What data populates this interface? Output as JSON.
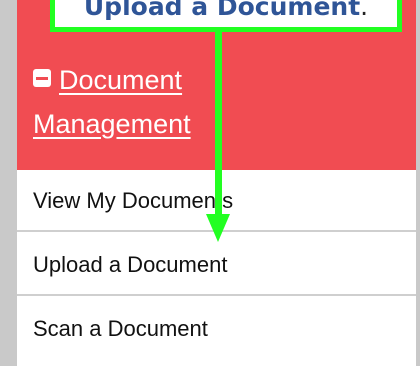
{
  "callout": {
    "text": "Upload a Document",
    "suffix": "."
  },
  "menu": {
    "header": {
      "icon": "minus-square-icon",
      "label": "Document Management"
    },
    "items": [
      {
        "label": "View My Documents"
      },
      {
        "label": "Upload a Document"
      },
      {
        "label": "Scan a Document"
      }
    ]
  },
  "colors": {
    "header_bg": "#f14c52",
    "callout_border": "#22ff22",
    "callout_text": "#2f5597"
  }
}
